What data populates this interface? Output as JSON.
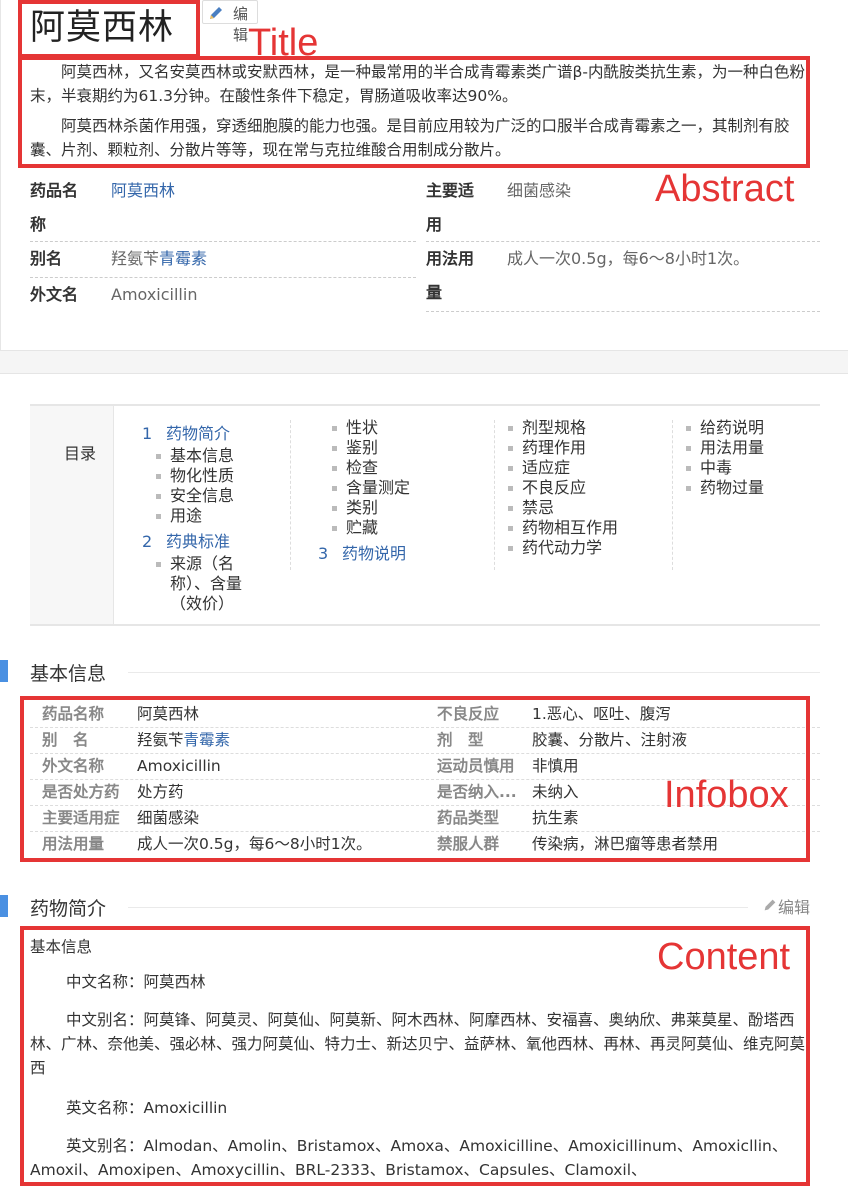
{
  "title": "阿莫西林",
  "edit_label": "编辑",
  "abstract": {
    "paragraphs": [
      "阿莫西林，又名安莫西林或安默西林，是一种最常用的半合成青霉素类广谱β-内酰胺类抗生素，为一种白色粉末，半衰期约为61.3分钟。在酸性条件下稳定，胃肠道吸收率达90%。",
      "阿莫西林杀菌作用强，穿透细胞膜的能力也强。是目前应用较为广泛的口服半合成青霉素之一，其制剂有胶囊、片剂、颗粒剂、分散片等等，现在常与克拉维酸合用制成分散片。"
    ]
  },
  "summary_info": {
    "drug_name_label_1": "药品名",
    "drug_name_label_2": "称",
    "drug_name": "阿莫西林",
    "alias_label": "别名",
    "alias_prefix": "羟氨苄",
    "alias_link": "青霉素",
    "foreign_label": "外文名",
    "foreign_name": "Amoxicillin",
    "indication_label_1": "主要适",
    "indication_label_2": "用",
    "indication": "细菌感染",
    "dosage_label_1": "用法用",
    "dosage_label_2": "量",
    "dosage": "成人一次0.5g，每6～8小时1次。"
  },
  "catalog": {
    "title": "目录",
    "col1": {
      "s1_num": "1",
      "s1_title": "药物简介",
      "s1_items": [
        "基本信息",
        "物化性质",
        "安全信息",
        "用途"
      ],
      "s2_num": "2",
      "s2_title": "药典标准",
      "s2_items": [
        "来源（名称）、含量（效价）"
      ]
    },
    "col2": {
      "items": [
        "性状",
        "鉴别",
        "检查",
        "含量测定",
        "类别",
        "贮藏"
      ],
      "s3_num": "3",
      "s3_title": "药物说明"
    },
    "col3": {
      "items": [
        "剂型规格",
        "药理作用",
        "适应症",
        "不良反应",
        "禁忌",
        "药物相互作用",
        "药代动力学"
      ]
    },
    "col4": {
      "items": [
        "给药说明",
        "用法用量",
        "中毒",
        "药物过量"
      ]
    }
  },
  "section_basic": {
    "title": "基本信息"
  },
  "infobox": {
    "rows": [
      {
        "l1": "药品名称",
        "v1": "阿莫西林",
        "l2": "不良反应",
        "v2": "1.恶心、呕吐、腹泻"
      },
      {
        "l1": "别　名",
        "v1a": "羟氨苄",
        "v1b": "青霉素",
        "l2": "剂　型",
        "v2": "胶囊、分散片、注射液"
      },
      {
        "l1": "外文名称",
        "v1": "Amoxicillin",
        "l2": "运动员慎用",
        "v2": "非慎用"
      },
      {
        "l1": "是否处方药",
        "v1": "处方药",
        "l2": "是否纳入...",
        "v2": "未纳入"
      },
      {
        "l1": "主要适用症",
        "v1": "细菌感染",
        "l2": "药品类型",
        "v2": "抗生素"
      },
      {
        "l1": "用法用量",
        "v1": "成人一次0.5g，每6～8小时1次。",
        "l2": "禁服人群",
        "v2": "传染病，淋巴瘤等患者禁用"
      }
    ]
  },
  "section_intro": {
    "title": "药物简介",
    "edit": "编辑"
  },
  "content": {
    "sub_heading": "基本信息",
    "cn_name": "中文名称：阿莫西林",
    "cn_alias": "中文别名：阿莫锋、阿莫灵、阿莫仙、阿莫新、阿木西林、阿摩西林、安福喜、奥纳欣、弗莱莫星、酚塔西林、广林、奈他美、强必林、强力阿莫仙、特力士、新达贝宁、益萨林、氧他西林、再林、再灵阿莫仙、维克阿莫西",
    "en_name": "英文名称：Amoxicillin",
    "en_alias": "英文别名：Almodan、Amolin、Bristamox、Amoxa、Amoxicilline、Amoxicillinum、Amoxicllin、Amoxil、Amoxipen、Amoxycillin、BRL-2333、Bristamox、Capsules、Clamoxil、"
  },
  "annotations": {
    "title": "Title",
    "abstract": "Abstract",
    "infobox": "Infobox",
    "content": "Content",
    "color": "#e53535"
  }
}
